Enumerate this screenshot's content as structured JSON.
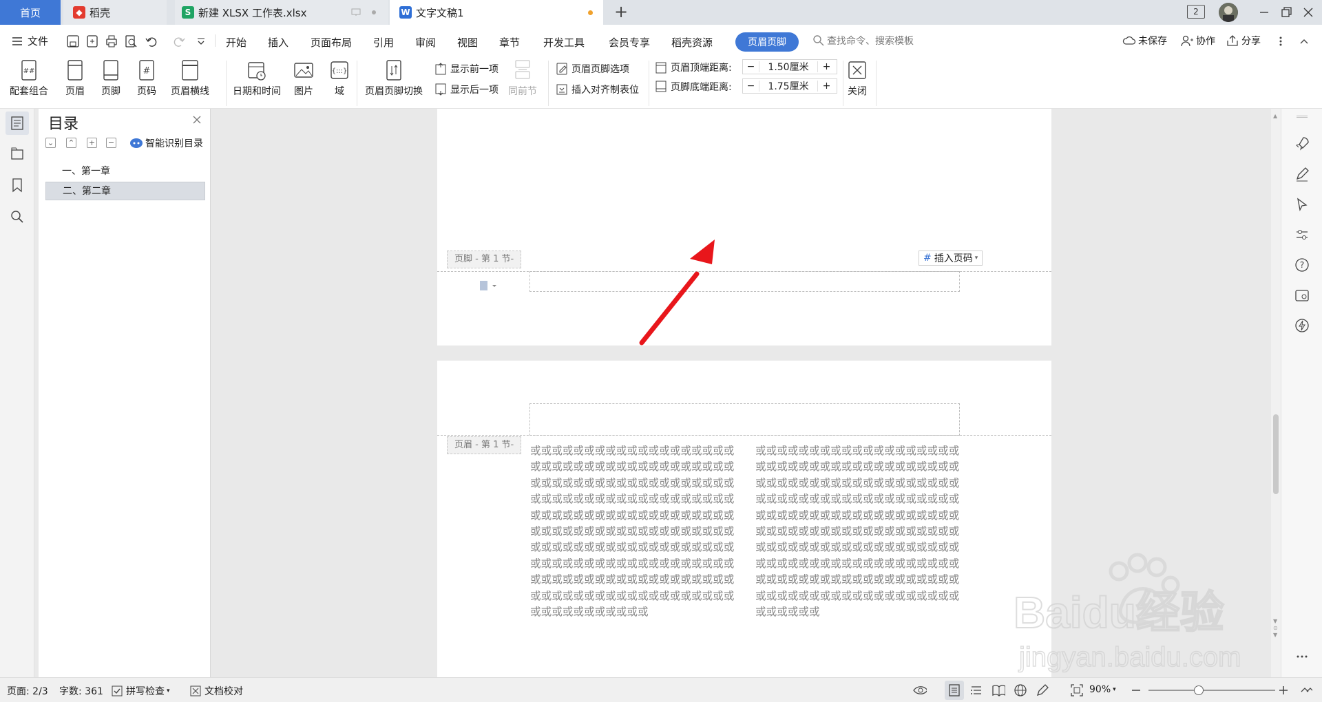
{
  "tabs": {
    "home": "首页",
    "daoke": "稻壳",
    "xlsx": "新建 XLSX 工作表.xlsx",
    "doc": "文字文稿1",
    "plus": "+",
    "window_count": "2"
  },
  "menu": {
    "file": "文件",
    "items": [
      "开始",
      "插入",
      "页面布局",
      "引用",
      "审阅",
      "视图",
      "章节",
      "开发工具",
      "会员专享",
      "稻壳资源"
    ],
    "active": "页眉页脚",
    "search_placeholder": "查找命令、搜索模板",
    "unsaved": "未保存",
    "collab": "协作",
    "share": "分享"
  },
  "ribbon": {
    "combo": "配套组合",
    "header": "页眉",
    "footer": "页脚",
    "page_number": "页码",
    "header_line": "页眉横线",
    "date_time": "日期和时间",
    "picture": "图片",
    "field": "域",
    "switch": "页眉页脚切换",
    "show_prev": "显示前一项",
    "show_next": "显示后一项",
    "same_as_prev": "同前节",
    "options": "页眉页脚选项",
    "insert_align_tab": "插入对齐制表位",
    "header_top_label": "页眉顶端距离:",
    "header_top_value": "1.50厘米",
    "footer_bottom_label": "页脚底端距离:",
    "footer_bottom_value": "1.75厘米",
    "close": "关闭"
  },
  "sidebar": {
    "title": "目录",
    "smart": "智能识别目录",
    "items": [
      {
        "label": "一、第一章",
        "selected": false
      },
      {
        "label": "二、第二章",
        "selected": true
      }
    ]
  },
  "document": {
    "footer_tag": "页脚 - 第 1 节-",
    "header_tag": "页眉 - 第 1 节-",
    "insert_page_number": "插入页码",
    "col1": "或或或或或或或或或或或或或或或或或或或或或或或或或或或或或或或或或或或或或或或或或或或或或或或或或或或或或或或或或或或或或或或或或或或或或或或或或或或或或或或或或或或或或或或或或或或或或或或或或或或或或或或或或或或或或或或或或或或或或或或或或或或或或或或或或或或或或或或或或或或或或或或或或或或或或或或或或或或或或或或或或或或或或或或或或或或或或或或或或或或或或或或或或或或或或或或或或或或或或或或或或",
    "col2": "或或或或或或或或或或或或或或或或或或或或或或或或或或或或或或或或或或或或或或或或或或或或或或或或或或或或或或或或或或或或或或或或或或或或或或或或或或或或或或或或或或或或或或或或或或或或或或或或或或或或或或或或或或或或或或或或或或或或或或或或或或或或或或或或或或或或或或或或或或或或或或或或或或或或或或或或或或或或或或或或或或或或或或或或或或或或或或或或或或或或或或或或或或或或或或或或或或或或"
  },
  "status": {
    "page": "页面: 2/3",
    "words": "字数: 361",
    "spellcheck": "拼写检查",
    "proofread": "文档校对",
    "zoom": "90%"
  },
  "watermark": {
    "brand": "Baidu经验",
    "url": "jingyan.baidu.com"
  },
  "colors": {
    "accent": "#3f78d6",
    "arrow": "#e8161b",
    "tab_bar": "#dfe3e8"
  }
}
